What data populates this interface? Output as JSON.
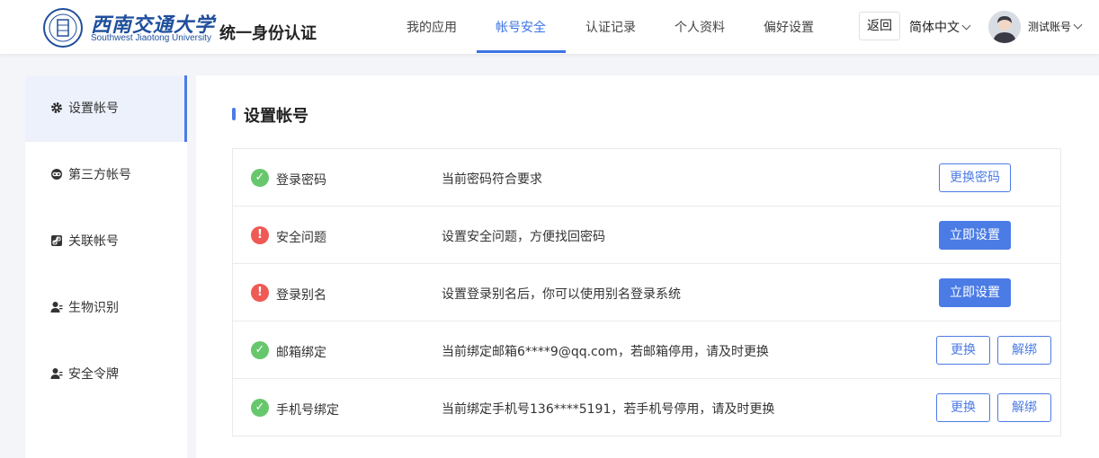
{
  "header": {
    "logo_name": "西南交通大学",
    "logo_sub": "Southwest Jiaotong University",
    "app_title": "统一身份认证",
    "nav": [
      "我的应用",
      "帐号安全",
      "认证记录",
      "个人资料",
      "偏好设置"
    ],
    "active_nav": "帐号安全",
    "back_label": "返回",
    "language": "简体中文",
    "username": "测试账号"
  },
  "sidebar": {
    "items": [
      {
        "label": "设置帐号",
        "icon": "gear-icon"
      },
      {
        "label": "第三方帐号",
        "icon": "link-icon"
      },
      {
        "label": "关联帐号",
        "icon": "chain-icon"
      },
      {
        "label": "生物识别",
        "icon": "person-icon"
      },
      {
        "label": "安全令牌",
        "icon": "person-icon"
      }
    ],
    "active": "设置帐号"
  },
  "main": {
    "section_title": "设置帐号",
    "rows": [
      {
        "name": "登录密码",
        "status": "ok",
        "desc": "当前密码符合要求",
        "buttons": [
          "更换密码"
        ]
      },
      {
        "name": "安全问题",
        "status": "warning",
        "desc": "设置安全问题，方便找回密码",
        "buttons": [
          "立即设置"
        ]
      },
      {
        "name": "登录别名",
        "status": "warning",
        "desc": "设置登录别名后，你可以使用别名登录系统",
        "buttons": [
          "立即设置"
        ]
      },
      {
        "name": "邮箱绑定",
        "status": "ok",
        "desc": "当前绑定邮箱6****9@qq.com，若邮箱停用，请及时更换",
        "buttons": [
          "更换",
          "解绑"
        ]
      },
      {
        "name": "手机号绑定",
        "status": "ok",
        "desc": "当前绑定手机号136****5191，若手机号停用，请及时更换",
        "buttons": [
          "更换",
          "解绑"
        ]
      }
    ]
  },
  "colors": {
    "accent": "#4b7be5",
    "ok": "#67c76d",
    "warning": "#f05a54"
  }
}
